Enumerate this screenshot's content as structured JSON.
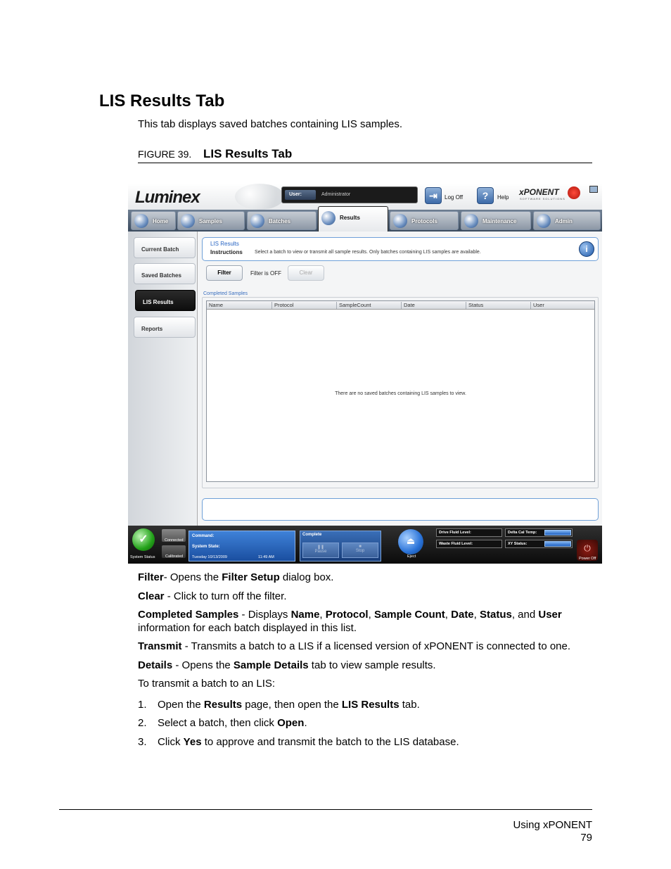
{
  "heading": "LIS Results Tab",
  "intro": "This tab displays saved batches containing LIS samples.",
  "figure": {
    "number": "FIGURE 39.",
    "title": "LIS Results Tab"
  },
  "app": {
    "logo": "Luminex",
    "user_label": "User:",
    "user_value": "Administrator",
    "logoff_label": "Log Off",
    "help_label": "Help",
    "brand": "xPONENT",
    "brand_sub": "SOFTWARE SOLUTIONS",
    "nav_tabs": [
      "Home",
      "Samples",
      "Batches",
      "Results",
      "Protocols",
      "Maintenance",
      "Admin"
    ],
    "side_tabs": [
      "Current Batch",
      "Saved Batches",
      "LIS Results",
      "Reports"
    ],
    "panel_title": "LIS Results",
    "instructions_label": "Instructions",
    "instructions_text": "Select a batch to view or transmit all sample results. Only batches containing LIS samples are available.",
    "filter_button": "Filter",
    "filter_status": "Filter is OFF",
    "clear_button": "Clear",
    "group_label": "Completed Samples",
    "columns": [
      "Name",
      "Protocol",
      "SampleCount",
      "Date",
      "Status",
      "User"
    ],
    "empty_message": "There are no saved batches containing LIS samples to view.",
    "status": {
      "system_status": "System Status",
      "connected": "Connected",
      "calibrated": "Calibrated",
      "command_label": "Command:",
      "system_state_label": "System State:",
      "date": "Tuesday 10/13/2009",
      "time": "11:49 AM",
      "complete": "Complete",
      "pause": "Pause",
      "stop": "Stop",
      "eject": "Eject",
      "drive_fluid": "Drive Fluid Level:",
      "waste_fluid": "Waste Fluid Level:",
      "delta_cal": "Delta Cal Temp:",
      "xy_status": "XY Status:",
      "power_off": "Power Off"
    }
  },
  "descriptions": [
    {
      "term": "Filter",
      "sep": "- Opens the ",
      "b1": "Filter Setup",
      "rest": " dialog box."
    },
    {
      "term": "Clear",
      "rest": " - Click to turn off the filter."
    },
    {
      "term": "Transmit",
      "rest": " - Transmits a batch to a LIS if a licensed version of xPONENT is connected to one."
    },
    {
      "term": "Details",
      "sep": " - Opens the ",
      "b1": "Sample Details",
      "rest": " tab to view sample results."
    }
  ],
  "completed_desc": {
    "term": "Completed Samples",
    "pre": " - Displays ",
    "f1": "Name",
    "f2": "Protocol",
    "f3": "Sample Count",
    "f4": "Date",
    "f5": "Status",
    "f6": "User",
    "and": ", and ",
    "post": "information for each batch displayed in this list."
  },
  "steps_intro": "To transmit a batch to an LIS:",
  "steps": [
    {
      "num": "1.",
      "a": "Open the ",
      "b": "Results",
      "c": " page, then open the ",
      "d": "LIS Results",
      "e": " tab."
    },
    {
      "num": "2.",
      "a": "Select a batch, then click ",
      "b": "Open",
      "c": "."
    },
    {
      "num": "3.",
      "a": "Click ",
      "b": "Yes",
      "c": " to approve and transmit the batch to the LIS database."
    }
  ],
  "footer": {
    "section": "Using xPONENT",
    "page": "79"
  }
}
